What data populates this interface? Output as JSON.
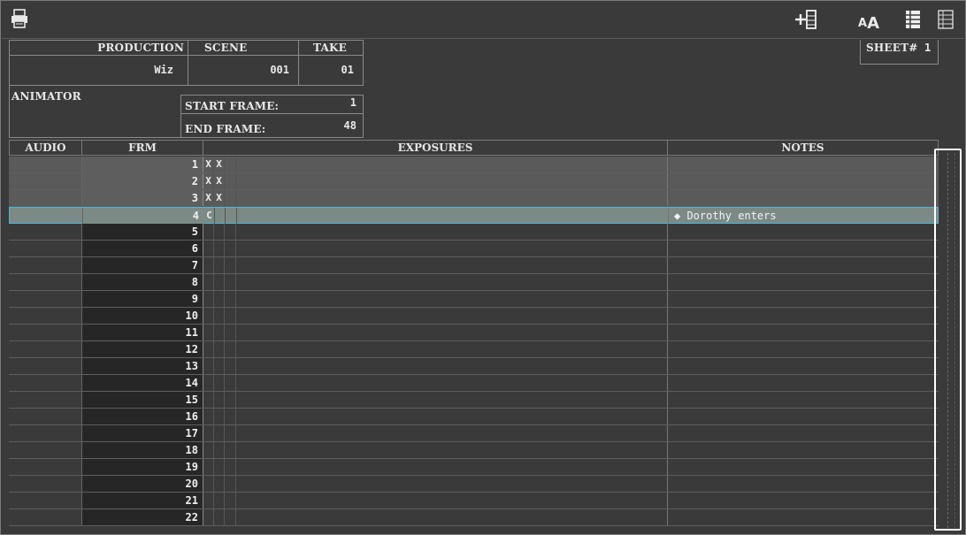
{
  "toolbar": {
    "print_icon": "printer-icon",
    "add_page_icon": "add-page-icon",
    "text_size_small": "A",
    "text_size_large": "A",
    "grid_view_icon": "grid-view-icon",
    "grid_view_alt_icon": "grid-view-alt-icon"
  },
  "header": {
    "production_label": "PRODUCTION",
    "production_value": "Wiz",
    "scene_label": "SCENE",
    "scene_value": "001",
    "take_label": "TAKE",
    "take_value": "01",
    "animator_label": "ANIMATOR",
    "start_frame_label": "START FRAME:",
    "start_frame_value": "1",
    "end_frame_label": "END FRAME:",
    "end_frame_value": "48",
    "sheet_label": "SHEET#",
    "sheet_value": "1"
  },
  "columns": {
    "audio": "AUDIO",
    "frm": "FRM",
    "exposures": "EXPOSURES",
    "notes": "NOTES"
  },
  "rows": [
    {
      "frame": "1",
      "e1": "X",
      "e2": "X",
      "note": "",
      "state": "filled"
    },
    {
      "frame": "2",
      "e1": "X",
      "e2": "X",
      "note": "",
      "state": "filled"
    },
    {
      "frame": "3",
      "e1": "X",
      "e2": "X",
      "note": "",
      "state": "filled"
    },
    {
      "frame": "4",
      "e1": "C",
      "e2": "",
      "note": "◆ Dorothy enters",
      "state": "selected"
    },
    {
      "frame": "5",
      "e1": "",
      "e2": "",
      "note": "",
      "state": "empty"
    },
    {
      "frame": "6",
      "e1": "",
      "e2": "",
      "note": "",
      "state": "empty"
    },
    {
      "frame": "7",
      "e1": "",
      "e2": "",
      "note": "",
      "state": "empty"
    },
    {
      "frame": "8",
      "e1": "",
      "e2": "",
      "note": "",
      "state": "empty"
    },
    {
      "frame": "9",
      "e1": "",
      "e2": "",
      "note": "",
      "state": "empty"
    },
    {
      "frame": "10",
      "e1": "",
      "e2": "",
      "note": "",
      "state": "empty"
    },
    {
      "frame": "11",
      "e1": "",
      "e2": "",
      "note": "",
      "state": "empty"
    },
    {
      "frame": "12",
      "e1": "",
      "e2": "",
      "note": "",
      "state": "empty"
    },
    {
      "frame": "13",
      "e1": "",
      "e2": "",
      "note": "",
      "state": "empty"
    },
    {
      "frame": "14",
      "e1": "",
      "e2": "",
      "note": "",
      "state": "empty"
    },
    {
      "frame": "15",
      "e1": "",
      "e2": "",
      "note": "",
      "state": "empty"
    },
    {
      "frame": "16",
      "e1": "",
      "e2": "",
      "note": "",
      "state": "empty"
    },
    {
      "frame": "17",
      "e1": "",
      "e2": "",
      "note": "",
      "state": "empty"
    },
    {
      "frame": "18",
      "e1": "",
      "e2": "",
      "note": "",
      "state": "empty"
    },
    {
      "frame": "19",
      "e1": "",
      "e2": "",
      "note": "",
      "state": "empty"
    },
    {
      "frame": "20",
      "e1": "",
      "e2": "",
      "note": "",
      "state": "empty"
    },
    {
      "frame": "21",
      "e1": "",
      "e2": "",
      "note": "",
      "state": "empty"
    },
    {
      "frame": "22",
      "e1": "",
      "e2": "",
      "note": "",
      "state": "empty"
    }
  ],
  "colors": {
    "background": "#3a3a3a",
    "selected_row": "#7c8a86",
    "selected_border": "#4fb6d6",
    "filled_row": "#5a5a5a"
  }
}
